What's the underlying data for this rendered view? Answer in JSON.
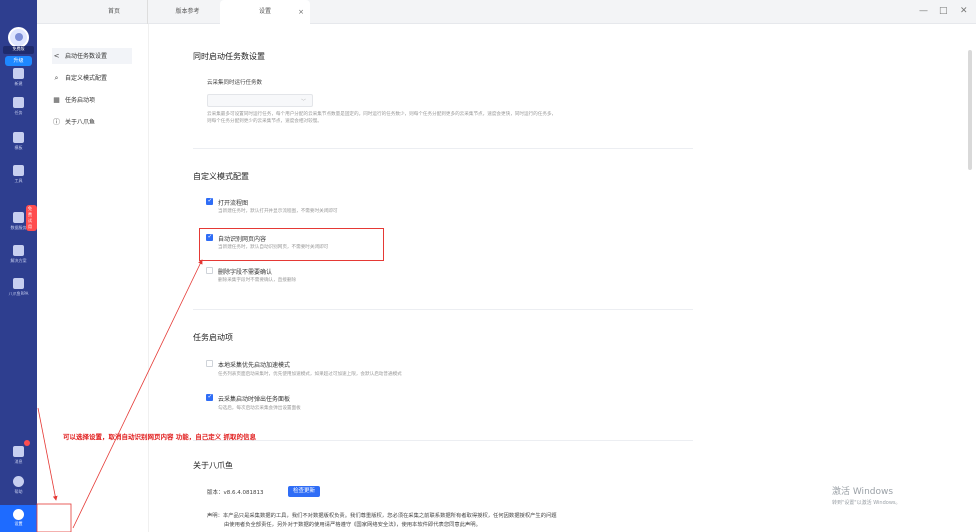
{
  "rail": {
    "avatar_label": "免费版",
    "upgrade_label": "升级",
    "items": [
      {
        "label": "新建"
      },
      {
        "label": "任务"
      },
      {
        "label": "模板"
      },
      {
        "label": "工具"
      },
      {
        "label": "数据服务"
      },
      {
        "label": "解决方案"
      },
      {
        "label": "八爪鱼RPA"
      }
    ],
    "badge_label": "免费试用",
    "bottom_items": [
      {
        "label": "消息"
      },
      {
        "label": "帮助"
      }
    ],
    "active_label": "设置"
  },
  "tabs": [
    {
      "label": "首页"
    },
    {
      "label": "版本参考"
    },
    {
      "label": "设置"
    }
  ],
  "window_controls": {
    "minimize": "—",
    "maximize": "□",
    "close": "✕"
  },
  "settings_nav": [
    {
      "label": "启动任务数设置",
      "icon": "share-icon"
    },
    {
      "label": "自定义模式配置",
      "icon": "brush-icon"
    },
    {
      "label": "任务启动项",
      "icon": "calendar-icon"
    },
    {
      "label": "关于八爪鱼",
      "icon": "info-icon"
    }
  ],
  "sections": {
    "concurrent": {
      "title": "同时启动任务数设置",
      "field_label": "云采集同时运行任务数",
      "desc1": "云采集最多可设置同时运行任务，每个用户分配的云采集节点数量是固定的。同时运行的任务数少，则每个任务分配到更多的云采集节点，速度会更快，同时运行的任务多，",
      "desc2": "则每个任务分配到更少的云采集节点，速度会相对较慢。"
    },
    "custom_mode": {
      "title": "自定义模式配置",
      "options": [
        {
          "label": "打开流程图",
          "desc": "当新建任务时，默认打开并显示流程图，不需要时关闭即可",
          "checked": true
        },
        {
          "label": "自动识别网页内容",
          "desc": "当新建任务时，默认自动识别网页，不需要时关闭即可",
          "checked": true
        },
        {
          "label": "删除字段不需要确认",
          "desc": "删除采集字段时不需要确认，直接删除",
          "checked": false
        }
      ]
    },
    "task_start": {
      "title": "任务启动项",
      "options": [
        {
          "label": "本地采集优先启动加速模式",
          "desc": "任务列表页面启动采集时，优先使用加速模式，如果超过可加速上限，会默认启动普通模式",
          "checked": false
        },
        {
          "label": "云采集启动时弹出任务面板",
          "desc": "勾选后，每次启动云采集会弹出设置面板",
          "checked": true
        }
      ]
    },
    "about": {
      "title": "关于八爪鱼",
      "version_label": "版本：v8.6.4.081813",
      "update_button": "检查更新",
      "declaration_line1": "声明：本产品只是采集数据的工具，我们不对数据版权负责。我们尊重版权，您必须在采集之前联系数据所有者取得授权，任何因数据授权产生的问题",
      "declaration_line2": "由使用者负全部责任，另外对于数据的使用请严格遵守《国家网络安全法》，使用本软件即代表您同意此声明。"
    }
  },
  "annotation": {
    "text": "可以选择设置，取消自动识别网页内容 功能，自己定义 抓取的信息",
    "color": "#e11d1d"
  },
  "watermark": {
    "line1": "激活 Windows",
    "line2": "转到\"设置\"以激活 Windows。"
  },
  "colors": {
    "rail": "#2e3e8f",
    "accent": "#2f6df6",
    "annotation_red": "#e53935"
  }
}
